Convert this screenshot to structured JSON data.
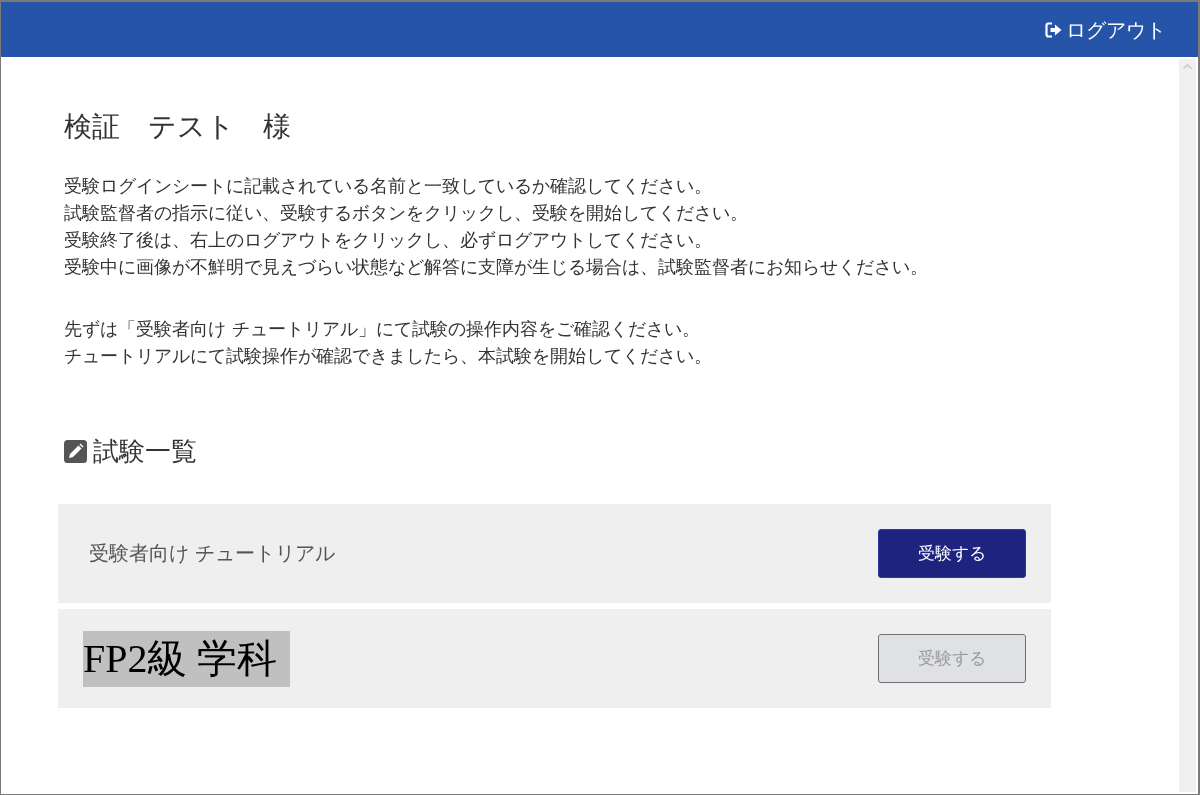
{
  "header": {
    "logout_label": "ログアウト"
  },
  "user": {
    "name": "検証　テスト　様"
  },
  "instructions": [
    {
      "lines": [
        "受験ログインシートに記載されている名前と一致しているか確認してください。",
        "試験監督者の指示に従い、受験するボタンをクリックし、受験を開始してください。",
        "受験終了後は、右上のログアウトをクリックし、必ずログアウトしてください。",
        "受験中に画像が不鮮明で見えづらい状態など解答に支障が生じる場合は、試験監督者にお知らせください。"
      ]
    },
    {
      "lines": [
        "先ずは「受験者向け チュートリアル」にて試験の操作内容をご確認ください。",
        "チュートリアルにて試験操作が確認できましたら、本試験を開始してください。"
      ]
    }
  ],
  "exam_list": {
    "heading": "試験一覧",
    "exams": [
      {
        "title": "受験者向け チュートリアル",
        "highlighted": false,
        "button": {
          "label": "受験する",
          "disabled": false
        }
      },
      {
        "title": "FP2級 学科",
        "highlighted": true,
        "button": {
          "label": "受験する",
          "disabled": true
        }
      }
    ]
  }
}
